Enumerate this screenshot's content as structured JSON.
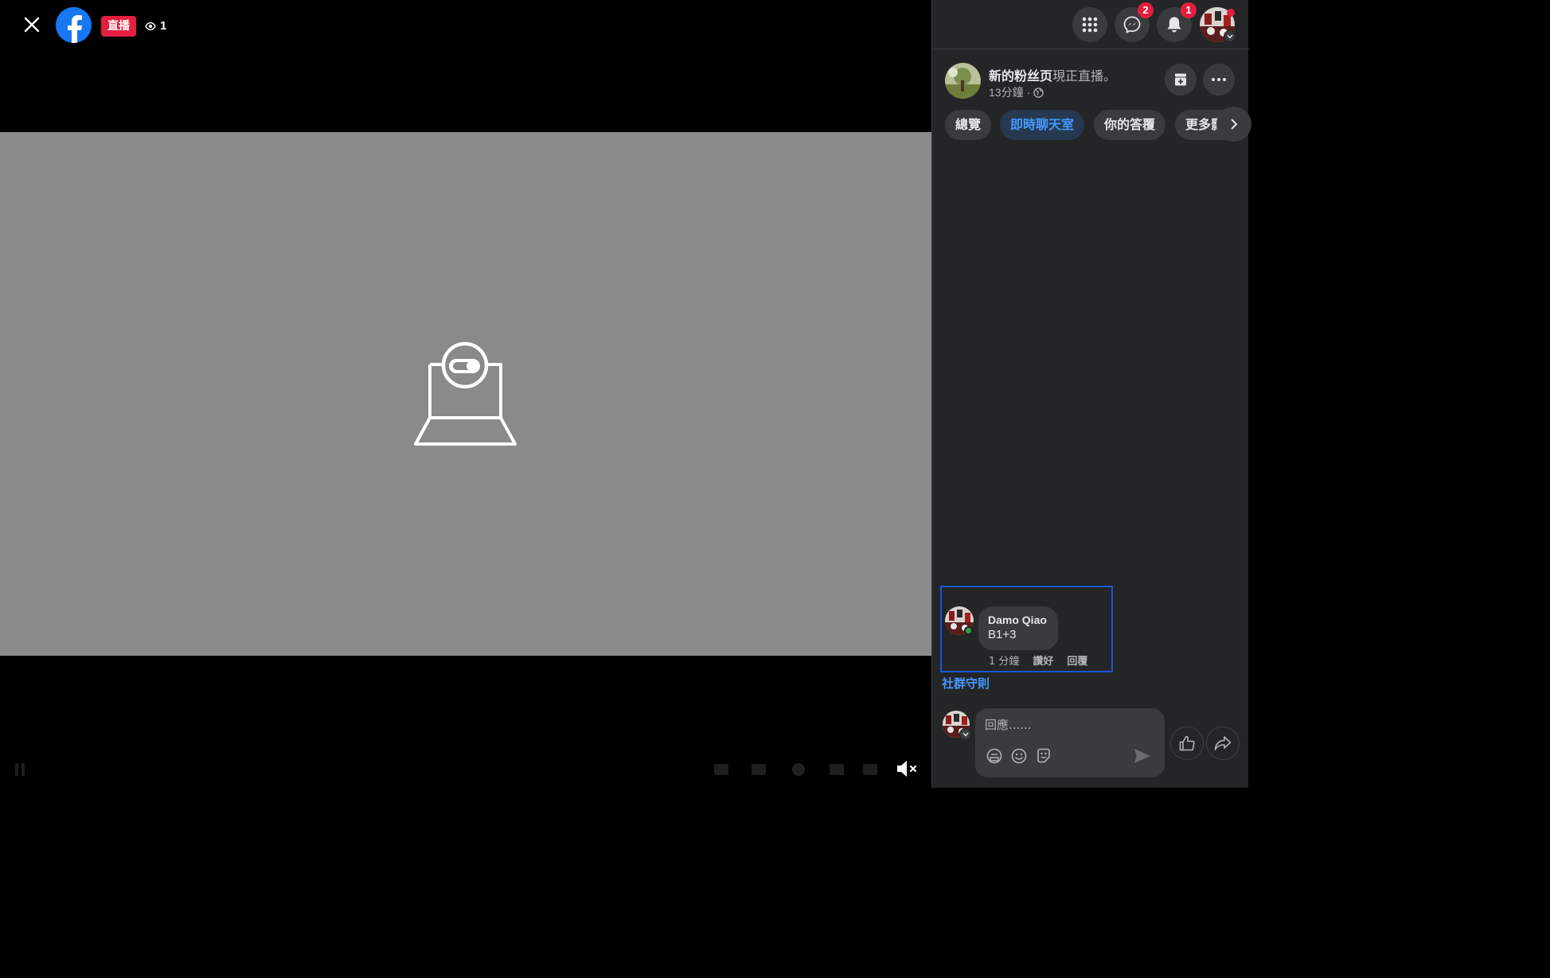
{
  "video": {
    "live_label": "直播",
    "viewer_count": "1"
  },
  "header": {
    "messenger_badge": "2",
    "notifications_badge": "1"
  },
  "post": {
    "page_name": "新的粉丝页",
    "status": "現正直播。",
    "time": "13分鐘 ·"
  },
  "tabs": [
    {
      "label": "總覽",
      "active": false
    },
    {
      "label": "即時聊天室",
      "active": true
    },
    {
      "label": "你的答覆",
      "active": false
    },
    {
      "label": "更多影片",
      "active": false
    }
  ],
  "comment": {
    "author": "Damo Qiao",
    "text": "B1+3",
    "time": "1 分鐘",
    "like_label": "讚好",
    "reply_label": "回覆"
  },
  "community_guidelines": "社群守則",
  "composer": {
    "placeholder": "回應......"
  },
  "colors": {
    "live_red": "#e41e3f",
    "facebook_blue": "#1877f2",
    "link_blue": "#4599ff",
    "panel_bg": "#242526",
    "video_placeholder": "#8a8a8b",
    "highlight_border": "#1a56db"
  }
}
